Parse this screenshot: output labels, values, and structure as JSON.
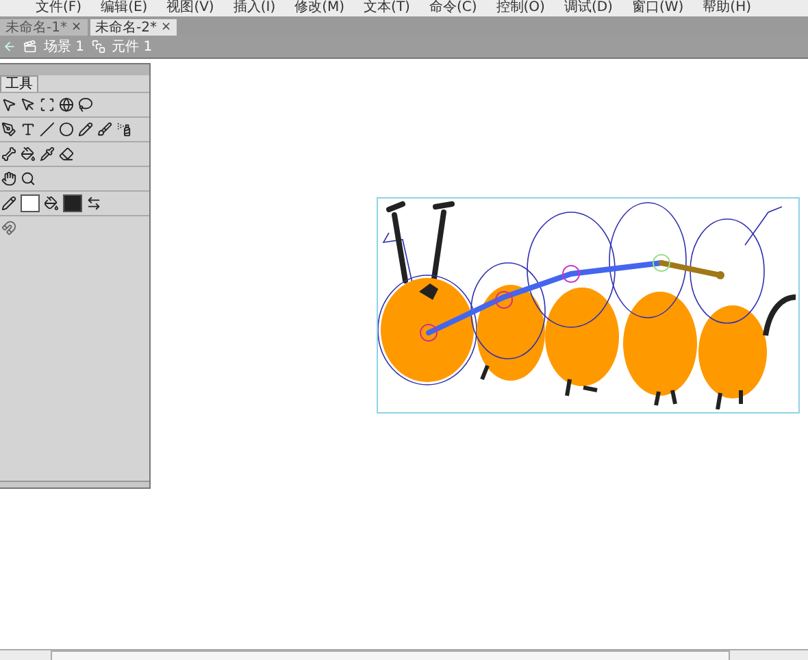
{
  "menu": [
    "文件(F)",
    "编辑(E)",
    "视图(V)",
    "插入(I)",
    "修改(M)",
    "文本(T)",
    "命令(C)",
    "控制(O)",
    "调试(D)",
    "窗口(W)",
    "帮助(H)"
  ],
  "tabs": [
    {
      "label": "未命名-1*",
      "close": "×",
      "selected": false
    },
    {
      "label": "未命名-2*",
      "close": "×",
      "selected": true
    }
  ],
  "breadcrumb": [
    {
      "label": "场景 1",
      "kind": "scene"
    },
    {
      "label": "元件 1",
      "kind": "symbol"
    }
  ],
  "tools_panel": {
    "title": "工具"
  }
}
